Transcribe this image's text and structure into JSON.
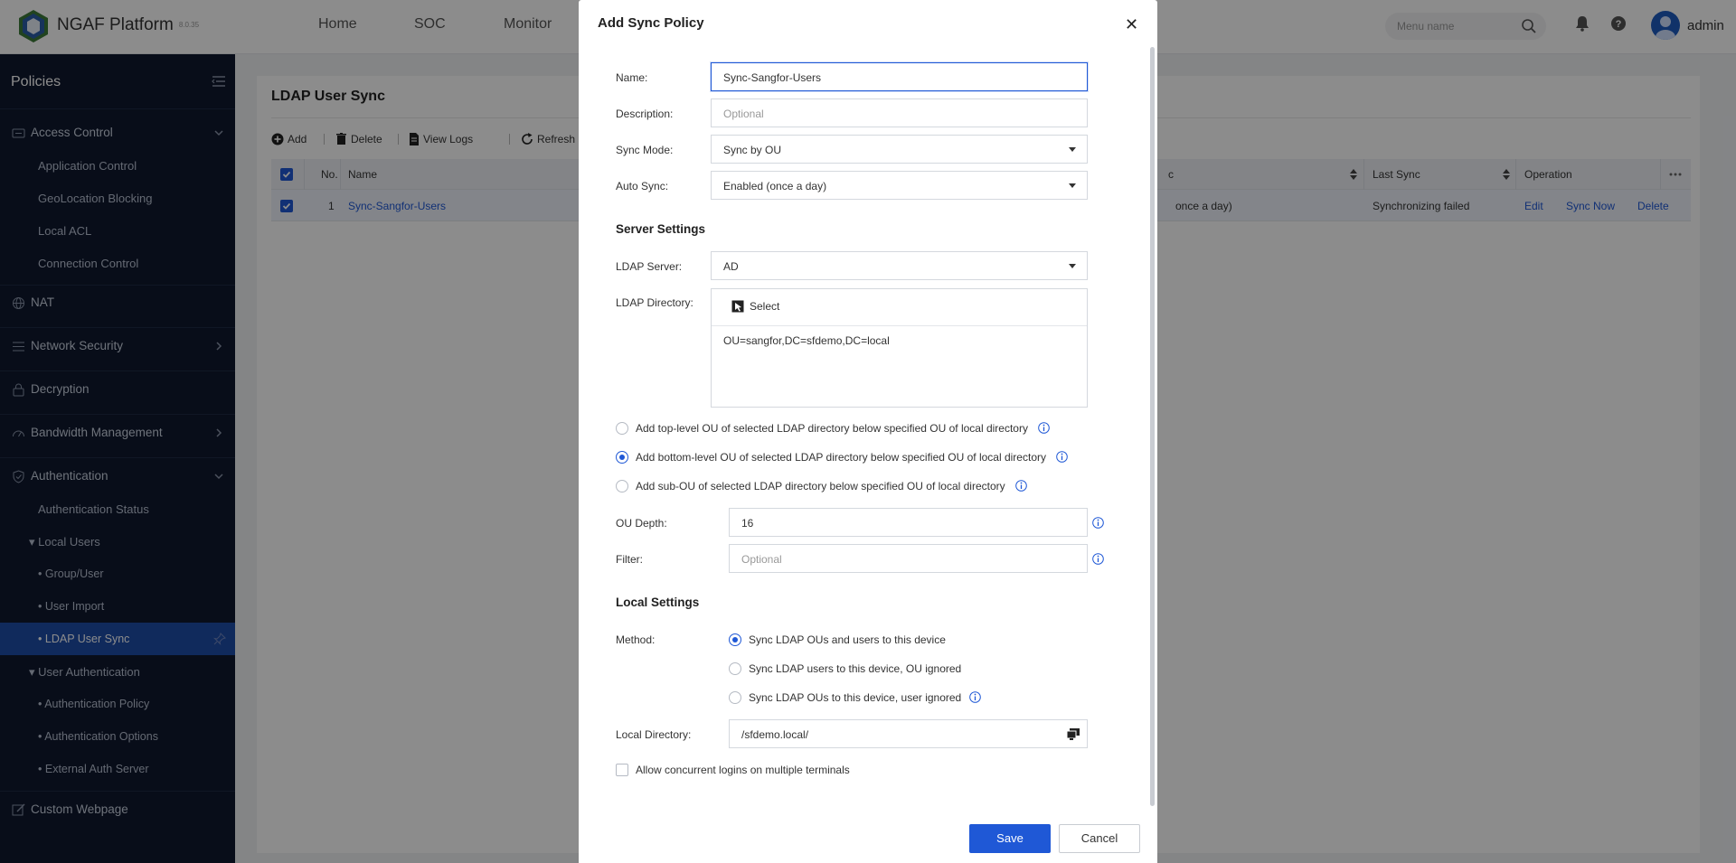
{
  "app": {
    "brand": "NGAF Platform",
    "version": "8.0.35",
    "nav": [
      "Home",
      "SOC",
      "Monitor"
    ],
    "search_placeholder": "Menu name",
    "user": "admin"
  },
  "sidebar": {
    "title": "Policies",
    "items": [
      {
        "label": "Access Control",
        "icon": "access-control-icon",
        "arrow": "down"
      },
      {
        "label": "Application Control"
      },
      {
        "label": "GeoLocation Blocking"
      },
      {
        "label": "Local ACL"
      },
      {
        "label": "Connection Control"
      },
      {
        "label": "NAT",
        "icon": "globe-icon"
      },
      {
        "label": "Network Security",
        "icon": "list-icon",
        "arrow": "right"
      },
      {
        "label": "Decryption",
        "icon": "lock-icon"
      },
      {
        "label": "Bandwidth Management",
        "icon": "gauge-icon",
        "arrow": "right"
      },
      {
        "label": "Authentication",
        "icon": "shield-check-icon",
        "arrow": "down"
      },
      {
        "label": "Authentication Status"
      },
      {
        "label": "Local Users",
        "prefix": "▾"
      },
      {
        "label": "Group/User",
        "prefix": "•"
      },
      {
        "label": "User Import",
        "prefix": "•"
      },
      {
        "label": "LDAP User Sync",
        "prefix": "•"
      },
      {
        "label": "User Authentication",
        "prefix": "▾"
      },
      {
        "label": "Authentication Policy",
        "prefix": "•"
      },
      {
        "label": "Authentication Options",
        "prefix": "•"
      },
      {
        "label": "External Auth Server",
        "prefix": "•"
      },
      {
        "label": "Custom Webpage",
        "icon": "edit-icon"
      }
    ]
  },
  "page": {
    "title": "LDAP User Sync",
    "toolbar": {
      "add": "Add",
      "delete": "Delete",
      "view_logs": "View Logs",
      "refresh": "Refresh"
    },
    "table": {
      "headers": {
        "no": "No.",
        "name": "Name",
        "auto_sync": "c",
        "last_sync": "Last Sync",
        "operation": "Operation"
      },
      "rows": [
        {
          "no": "1",
          "name": "Sync-Sangfor-Users",
          "auto_sync": "once a day)",
          "last_sync": "Synchronizing failed",
          "ops": [
            "Edit",
            "Sync Now",
            "Delete"
          ]
        }
      ]
    }
  },
  "modal": {
    "title": "Add Sync Policy",
    "close": "✕",
    "fields": {
      "name_label": "Name:",
      "name_value": "Sync-Sangfor-Users",
      "desc_label": "Description:",
      "desc_placeholder": "Optional",
      "sync_mode_label": "Sync Mode:",
      "sync_mode_value": "Sync by OU",
      "auto_sync_label": "Auto Sync:",
      "auto_sync_value": "Enabled (once a day)"
    },
    "server": {
      "heading": "Server Settings",
      "ldap_server_label": "LDAP Server:",
      "ldap_server_value": "AD",
      "ldap_dir_label": "LDAP Directory:",
      "select_label": "Select",
      "dir_value": "OU=sangfor,DC=sfdemo,DC=local"
    },
    "ou_options": [
      {
        "label": "Add top-level OU of selected LDAP directory below specified OU of local directory",
        "selected": false
      },
      {
        "label": "Add bottom-level OU of selected LDAP directory below specified OU of local directory",
        "selected": true
      },
      {
        "label": "Add sub-OU of selected LDAP directory below specified OU of local directory",
        "selected": false
      }
    ],
    "ou_depth_label": "OU Depth:",
    "ou_depth_value": "16",
    "filter_label": "Filter:",
    "filter_placeholder": "Optional",
    "local": {
      "heading": "Local Settings",
      "method_label": "Method:",
      "methods": [
        {
          "label": "Sync LDAP OUs and users to this device",
          "selected": true
        },
        {
          "label": "Sync LDAP users to this device, OU ignored",
          "selected": false
        },
        {
          "label": "Sync LDAP OUs to this device, user ignored",
          "selected": false
        }
      ],
      "local_dir_label": "Local Directory:",
      "local_dir_value": "/sfdemo.local/"
    },
    "concurrent_label": "Allow concurrent logins on multiple terminals",
    "save": "Save",
    "cancel": "Cancel"
  },
  "colors": {
    "accent": "#1f58d6",
    "sidebar_bg": "#10192e",
    "sidebar_active": "#1e4ea8"
  }
}
